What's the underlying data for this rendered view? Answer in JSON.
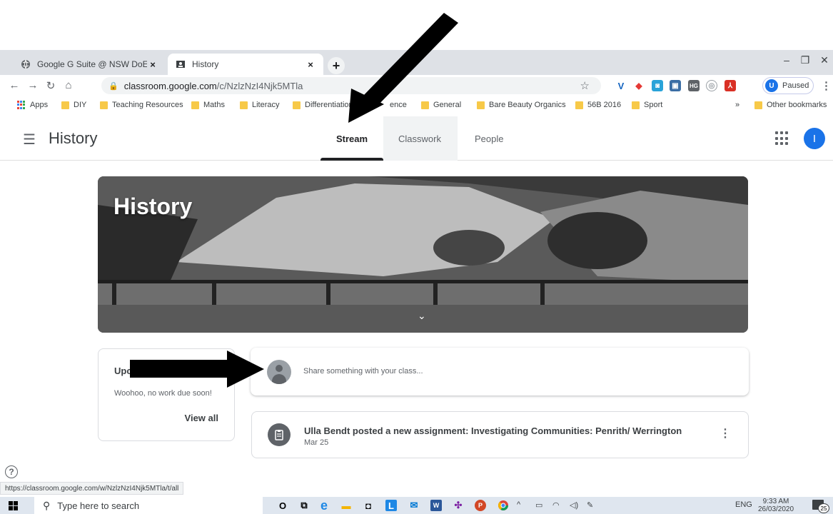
{
  "browser": {
    "tabs": [
      {
        "title": "Google G Suite @ NSW DoE",
        "active": false,
        "icon": "globe-icon"
      },
      {
        "title": "History",
        "active": true,
        "icon": "classroom-icon"
      }
    ],
    "new_tab_label": "+",
    "close_label": "×",
    "url_host": "classroom.google.com",
    "url_path": "/c/NzlzNzI4Njk5MTla",
    "profile_initial": "U",
    "profile_status": "Paused",
    "bookmarks": [
      {
        "label": "Apps",
        "icon": "apps-grid-icon"
      },
      {
        "label": "DIY"
      },
      {
        "label": "Teaching Resources"
      },
      {
        "label": "Maths"
      },
      {
        "label": "Literacy"
      },
      {
        "label": "Differentiation"
      },
      {
        "label": "ence"
      },
      {
        "label": "General"
      },
      {
        "label": "Bare Beauty Organics"
      },
      {
        "label": "56B 2016"
      },
      {
        "label": "Sport"
      }
    ],
    "bookmarks_overflow": "»",
    "other_bookmarks": "Other bookmarks"
  },
  "classroom": {
    "class_name": "History",
    "tabs": [
      {
        "label": "Stream",
        "active": true
      },
      {
        "label": "Classwork",
        "active": false
      },
      {
        "label": "People",
        "active": false
      }
    ],
    "user_initial": "I",
    "banner_title": "History",
    "upcoming": {
      "title": "Upc",
      "message": "Woohoo, no work due soon!",
      "link": "View all"
    },
    "share_placeholder": "Share something with your class...",
    "post": {
      "title": "Ulla Bendt posted a new assignment: Investigating Communities: Penrith/ Werrington",
      "date": "Mar 25"
    },
    "help_label": "?",
    "status_url": "https://classroom.google.com/w/NzlzNzI4Njk5MTla/t/all"
  },
  "taskbar": {
    "search_placeholder": "Type here to search",
    "language": "ENG",
    "time": "9:33 AM",
    "date": "26/03/2020",
    "notification_count": "25"
  },
  "colors": {
    "accent": "#1a73e8",
    "tab_bar": "#dee1e6",
    "taskbar": "#dfe6ef",
    "folder": "#f7c948"
  }
}
